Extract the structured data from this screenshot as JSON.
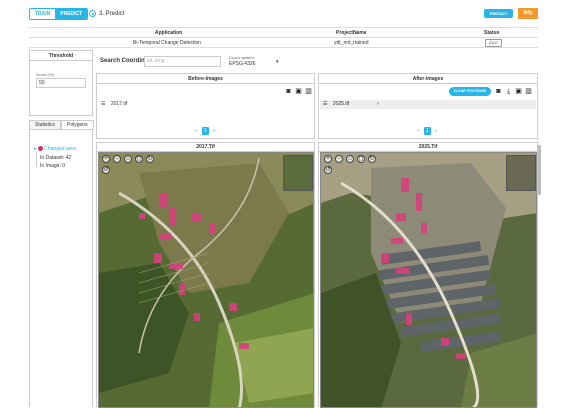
{
  "header": {
    "mode_tabs": [
      "TRAIN",
      "PREDICT"
    ],
    "active_mode": "PREDICT",
    "step_label": "3. Predict",
    "predict_button": "PREDICT",
    "logo_text": "lbfy"
  },
  "project_table": {
    "columns": [
      "Application",
      "ProjectName",
      "Status"
    ],
    "row": {
      "application": "Bi-Temporal Change Detection",
      "project_name": "ydt_not_trained",
      "status": "IDLE"
    }
  },
  "threshold": {
    "title": "Threshold",
    "score_label": "Score (%)",
    "score_value": "50"
  },
  "search": {
    "label": "Search Coordinates:",
    "placeholder": "lat, long",
    "coord_label": "Coord system",
    "coord_value": "EPSG:4326"
  },
  "side_tabs": [
    "Statistics",
    "Polygons"
  ],
  "stats": {
    "root": "Changed area",
    "in_dataset": "In Dataset: 42",
    "in_image": "In Image: 0"
  },
  "before": {
    "title": "Before-Images",
    "file": "2017.tif",
    "page": "1",
    "map_title": "2017.Tif"
  },
  "after": {
    "title": "After-Images",
    "clear_button": "CLEAR POLYGONS",
    "file": "2025.tif",
    "page": "1",
    "map_title": "2025.Tif"
  },
  "colors": {
    "accent": "#29b6e6",
    "change": "#d62c6e",
    "logo": "#f29a2e"
  }
}
